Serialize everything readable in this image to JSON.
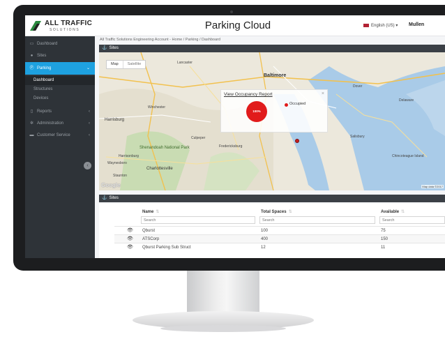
{
  "header": {
    "logo_title": "ALL TRAFFIC",
    "logo_subtitle": "SOLUTIONS",
    "app_title": "Parking Cloud",
    "language": "English (US) ▾",
    "user": "Mullen"
  },
  "sidebar": {
    "items": [
      {
        "label": "Dashboard",
        "icon": "monitor-icon"
      },
      {
        "label": "Sites",
        "icon": "globe-icon"
      },
      {
        "label": "Parking",
        "icon": "parking-icon"
      },
      {
        "label": "Reports",
        "icon": "file-icon"
      },
      {
        "label": "Administration",
        "icon": "gear-icon"
      },
      {
        "label": "Customer Service",
        "icon": "folder-icon"
      }
    ],
    "parking_sub": [
      "Dashboard",
      "Structures",
      "Devices"
    ],
    "active_color": "#1ea1e0"
  },
  "breadcrumb": "All Traffic Solutions Engineering Account - Home / Parking / Dashboard",
  "map_panel": {
    "title": "Sites",
    "toggle": [
      "Map",
      "Satellite"
    ],
    "popup_link": "View Occupancy Report",
    "occupancy_value": "100%",
    "legend_label": "Occupied",
    "google": "Google",
    "map_data": "Map data ©2017",
    "labels": {
      "baltimore": "Baltimore",
      "dover": "Dover",
      "harrisburg": "Harrisburg",
      "shenandoah": "Shenandoah National Park",
      "charlottesville": "Charlottesville",
      "salisbury": "Salisbury",
      "delaware": "Delaware",
      "fredericksburg": "Fredericksburg",
      "winchester": "Winchester",
      "staunton": "Staunton",
      "harrisonburg": "Harrisonburg",
      "lancaster": "Lancaster",
      "culpeper": "Culpeper",
      "waynesboro": "Waynesboro",
      "chincoteague": "Chincoteague Island"
    }
  },
  "sites_panel": {
    "title": "Sites",
    "columns": [
      "Name",
      "Total Spaces",
      "Available"
    ],
    "search_placeholder": "Search",
    "rows": [
      {
        "name": "Qburst",
        "total": "100",
        "available": "75"
      },
      {
        "name": "ATSCorp",
        "total": "400",
        "available": "150"
      },
      {
        "name": "Qburst Parking Sub Struct",
        "total": "12",
        "available": "11"
      }
    ]
  }
}
